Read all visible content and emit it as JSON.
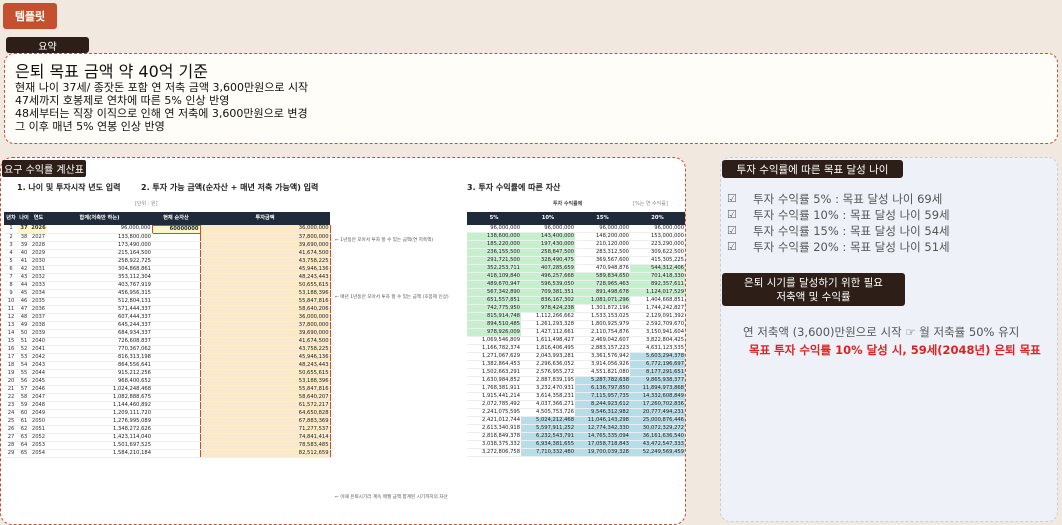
{
  "template_button": "템플릿",
  "summary": {
    "label": "요약",
    "title": "은퇴 목표 금액 약 40억 기준",
    "lines": [
      "현재 나이 37세/ 종잣돈 포함 연 저축 금액 3,600만원으로 시작",
      "47세까지 호봉제로 연차에 따른 5% 인상 반영",
      "48세부터는 직장 이직으로 인해 연 저축에 3,600만원으로 변경",
      "그 이후 매년 5% 연봉 인상 반영"
    ]
  },
  "calc": {
    "label": "요구 수익률 계산표",
    "section1_title": "1. 나이 및 투자시작 년도 입력",
    "section2_title": "2. 투자 가능 금액(순자산 + 매년 저축 가능액) 입력",
    "section3_title": "3. 투자 수익률에 따른 자산",
    "unit_note": "[단위 : 원]",
    "return_note": "투자 수익률에",
    "annual_note": "[%는 연 수익률]",
    "headers": [
      "년차",
      "나이",
      "연도",
      "합계(저축만 하는)",
      "현재 순자산",
      "투자금액"
    ],
    "rate_headers": [
      "5%",
      "10%",
      "15%",
      "20%"
    ],
    "current_asset": "60000000",
    "notes": [
      "← 1년동안 모아서 투자 할 수 있는 금액(연 저축액)",
      "← 매년 1년동안 모아서 투자 할 수 있는 금액 (호봉제 인상)",
      "← 매년 1년동안 모아서 투자 할 수 있는 금액 (호봉제 인상 후 이직)",
      "← 이때 은퇴시기라 계속 매월 금액 합계된 시기까지의 자산"
    ],
    "rows": [
      [
        "1",
        "37",
        "2026",
        "96,000,000",
        "36,000,000",
        "96,000,000",
        "96,000,000",
        "96,000,000",
        "96,000,000"
      ],
      [
        "2",
        "38",
        "2027",
        "133,800,000",
        "37,800,000",
        "138,600,000",
        "143,400,000",
        "148,200,000",
        "153,000,000"
      ],
      [
        "3",
        "39",
        "2028",
        "173,490,000",
        "39,690,000",
        "185,220,000",
        "197,430,000",
        "210,120,000",
        "223,290,000"
      ],
      [
        "4",
        "40",
        "2029",
        "215,164,500",
        "41,674,500",
        "236,155,500",
        "258,847,500",
        "283,312,500",
        "309,622,500"
      ],
      [
        "5",
        "41",
        "2030",
        "258,922,725",
        "43,758,225",
        "291,721,500",
        "328,490,475",
        "369,567,600",
        "415,305,225"
      ],
      [
        "6",
        "42",
        "2031",
        "304,868,861",
        "45,946,136",
        "352,253,711",
        "407,285,659",
        "470,948,876",
        "544,312,406"
      ],
      [
        "7",
        "43",
        "2032",
        "353,112,304",
        "48,243,443",
        "418,109,840",
        "496,257,668",
        "589,834,650",
        "701,418,330"
      ],
      [
        "8",
        "44",
        "2033",
        "403,767,919",
        "50,655,615",
        "489,670,947",
        "596,539,050",
        "728,965,463",
        "892,357,611"
      ],
      [
        "9",
        "45",
        "2034",
        "456,956,315",
        "53,188,396",
        "567,342,890",
        "709,381,351",
        "891,498,678",
        "1,124,017,529"
      ],
      [
        "10",
        "46",
        "2035",
        "512,804,131",
        "55,847,816",
        "651,557,851",
        "836,167,302",
        "1,081,071,296",
        "1,404,668,851"
      ],
      [
        "11",
        "47",
        "2036",
        "571,444,337",
        "58,640,206",
        "742,775,950",
        "978,424,238",
        "1,301,872,196",
        "1,744,242,827"
      ],
      [
        "12",
        "48",
        "2037",
        "607,444,337",
        "36,000,000",
        "815,914,748",
        "1,112,266,662",
        "1,533,153,025",
        "2,129,091,392"
      ],
      [
        "13",
        "49",
        "2038",
        "645,244,337",
        "37,800,000",
        "894,510,485",
        "1,261,293,328",
        "1,800,925,979",
        "2,592,709,670"
      ],
      [
        "14",
        "50",
        "2039",
        "684,934,337",
        "39,690,000",
        "978,926,009",
        "1,427,112,661",
        "2,110,754,876",
        "3,150,941,604"
      ],
      [
        "15",
        "51",
        "2040",
        "726,608,837",
        "41,674,500",
        "1,069,546,809",
        "1,611,498,427",
        "2,469,042,607",
        "3,822,804,425"
      ],
      [
        "16",
        "52",
        "2041",
        "770,367,062",
        "43,758,225",
        "1,166,782,374",
        "1,816,406,495",
        "2,883,157,223",
        "4,631,123,535"
      ],
      [
        "17",
        "53",
        "2042",
        "816,313,198",
        "45,946,136",
        "1,271,067,629",
        "2,043,993,281",
        "3,361,576,942",
        "5,603,294,378"
      ],
      [
        "18",
        "54",
        "2043",
        "864,556,641",
        "48,243,443",
        "1,382,864,453",
        "2,296,636,052",
        "3,914,056,926",
        "6,772,196,697"
      ],
      [
        "19",
        "55",
        "2044",
        "915,212,256",
        "50,655,615",
        "1,502,663,291",
        "2,576,955,272",
        "4,551,821,080",
        "8,177,291,651"
      ],
      [
        "20",
        "56",
        "2045",
        "968,400,652",
        "53,188,396",
        "1,630,984,852",
        "2,887,839,195",
        "5,287,782,638",
        "9,865,938,377"
      ],
      [
        "21",
        "57",
        "2046",
        "1,024,248,468",
        "55,847,816",
        "1,768,381,911",
        "3,232,470,931",
        "6,136,797,850",
        "11,894,973,868"
      ],
      [
        "22",
        "58",
        "2047",
        "1,082,888,675",
        "58,640,207",
        "1,915,441,214",
        "3,614,358,231",
        "7,115,957,735",
        "14,332,608,849"
      ],
      [
        "23",
        "59",
        "2048",
        "1,144,460,892",
        "61,572,217",
        "2,072,785,492",
        "4,037,366,271",
        "8,244,923,612",
        "17,260,702,836"
      ],
      [
        "24",
        "60",
        "2049",
        "1,209,111,720",
        "64,650,828",
        "2,241,075,595",
        "4,505,753,726",
        "9,546,312,982",
        "20,777,494,231"
      ],
      [
        "25",
        "61",
        "2050",
        "1,276,995,089",
        "67,883,369",
        "2,421,012,744",
        "5,024,212,468",
        "11,046,143,298",
        "25,000,876,446"
      ],
      [
        "26",
        "62",
        "2051",
        "1,348,272,626",
        "71,277,537",
        "2,613,340,918",
        "5,597,911,252",
        "12,774,342,330",
        "30,072,329,272"
      ],
      [
        "27",
        "63",
        "2052",
        "1,423,114,040",
        "74,841,414",
        "2,818,849,378",
        "6,232,543,791",
        "14,765,335,094",
        "36,161,636,540"
      ],
      [
        "28",
        "64",
        "2053",
        "1,501,697,525",
        "78,583,485",
        "3,038,375,332",
        "6,934,381,655",
        "17,058,718,843",
        "43,472,547,333"
      ],
      [
        "29",
        "65",
        "2054",
        "1,584,210,184",
        "82,512,659",
        "3,272,806,758",
        "7,710,332,480",
        "19,700,039,328",
        "52,249,569,459"
      ]
    ]
  },
  "side": {
    "label1": "투자 수익률에 따른 목표 달성 나이",
    "goals": [
      "투자 수익률 5% : 목표 달성 나이 69세",
      "투자 수익률 10% : 목표 달성 나이 59세",
      "투자 수익률 15% : 목표 달성 나이 54세",
      "투자 수익률 20% : 목표 달성 나이 51세"
    ],
    "label2_line1": "은퇴 시기를 달성하기 위한 필요",
    "label2_line2": "저축액 및 수익률",
    "body_gray": "연 저축액 (3,600)만원으로 시작 ☞ 월 저축률 50% 유지",
    "body_red": "목표 투자 수익률 10% 달성 시, 59세(2048년) 은퇴 목표"
  },
  "colors": {
    "accent": "#c4502f",
    "dark_label": "#2d1f18",
    "green_cell": "#c6efce",
    "teal_cell": "#b7dee8",
    "beige_col": "#fbe9c9"
  }
}
